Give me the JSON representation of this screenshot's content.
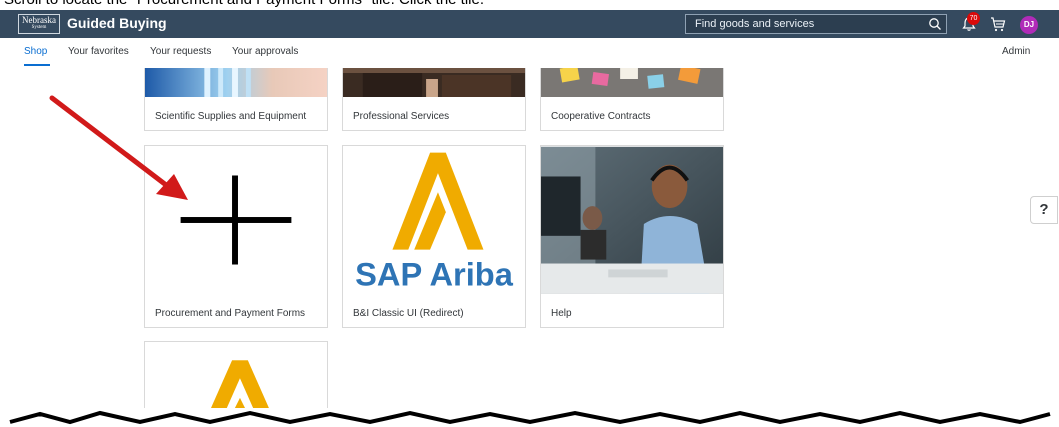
{
  "caption": "Scroll to locate the \"Procurement and Payment Forms\" tile. Click the tile.",
  "header": {
    "logo_text": "Nebraska",
    "logo_sub": "System",
    "app_title": "Guided Buying",
    "search_placeholder": "Find goods and services",
    "notification_count": "70",
    "avatar_initials": "DJ"
  },
  "nav": {
    "tabs": [
      "Shop",
      "Your favorites",
      "Your requests",
      "Your approvals"
    ],
    "active_tab": "Shop",
    "admin_label": "Admin"
  },
  "tiles": {
    "row1": [
      {
        "label": "Scientific Supplies and Equipment"
      },
      {
        "label": "Professional Services"
      },
      {
        "label": "Cooperative Contracts"
      }
    ],
    "row2": [
      {
        "label": "Procurement and Payment Forms"
      },
      {
        "label": "B&I Classic UI (Redirect)",
        "logo_text": "SAP Ariba"
      },
      {
        "label": "Help"
      }
    ]
  },
  "help_button": "?",
  "colors": {
    "shell": "#354a5f",
    "accent": "#0a6ed1",
    "ariba_gold": "#f0ab00",
    "ariba_blue": "#2e74b5",
    "arrow": "#d11a1a",
    "avatar": "#b02bb8"
  }
}
